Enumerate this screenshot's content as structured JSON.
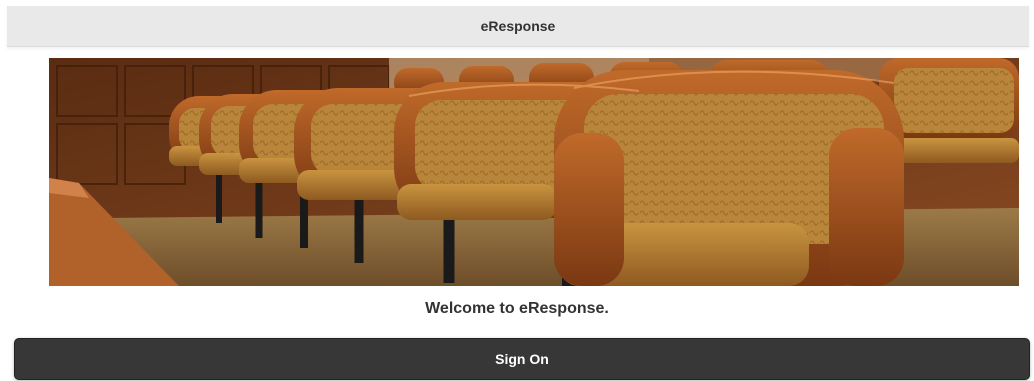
{
  "header": {
    "title": "eResponse"
  },
  "banner": {
    "image_subject": "courtroom-jury-chairs"
  },
  "main": {
    "welcome_text": "Welcome to eResponse."
  },
  "actions": {
    "signon_label": "Sign On"
  },
  "colors": {
    "header_bg": "#e9e9e9",
    "button_bg": "#373737",
    "button_text": "#ffffff",
    "text": "#333333"
  }
}
